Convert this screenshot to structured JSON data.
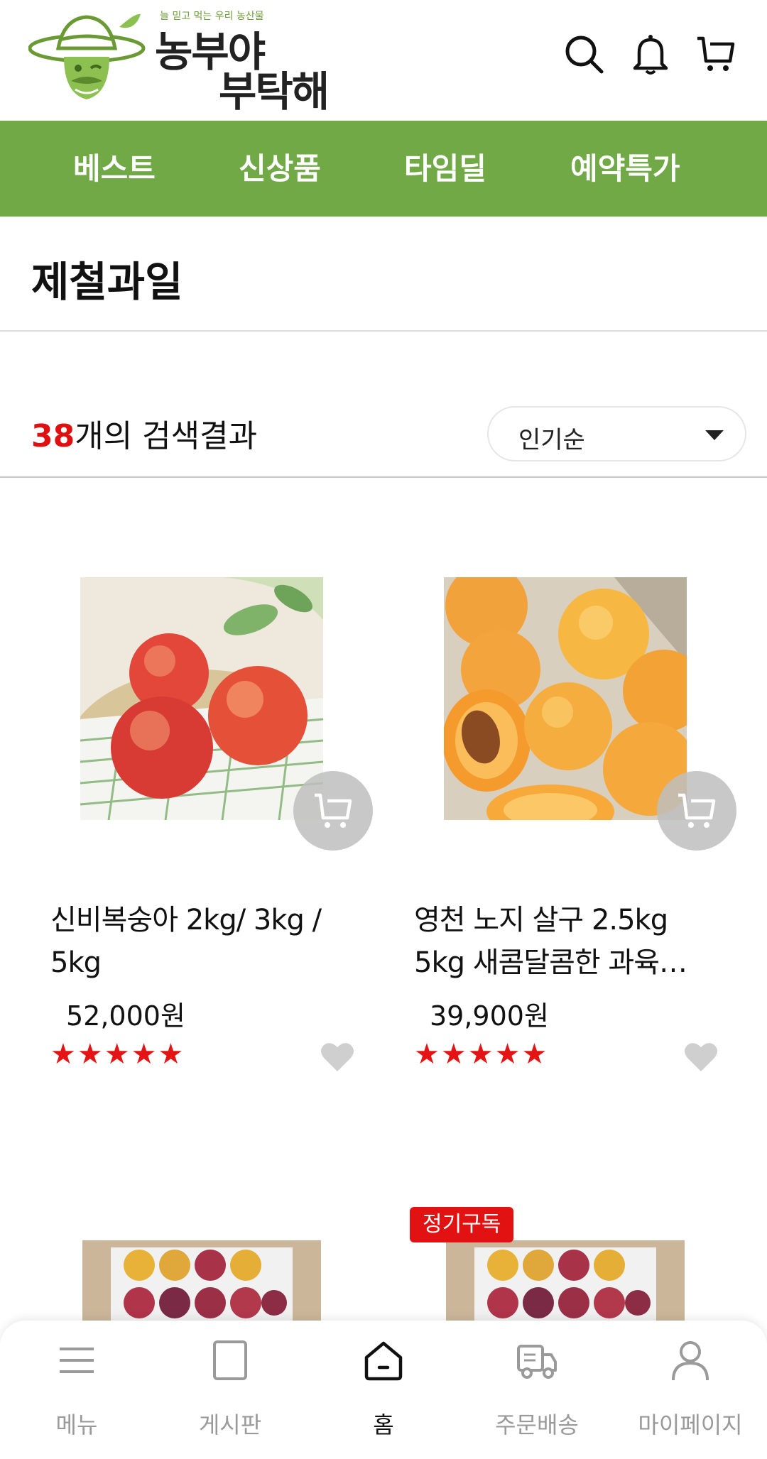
{
  "header": {
    "logo": {
      "tagline": "늘 믿고 먹는 우리 농산물",
      "line1": "농부야",
      "line2": "부탁해"
    },
    "icons": [
      "search-icon",
      "bell-icon",
      "cart-icon"
    ]
  },
  "nav": {
    "items": [
      "베스트",
      "신상품",
      "타임딜",
      "예약특가"
    ]
  },
  "page": {
    "title": "제철과일"
  },
  "results": {
    "count": "38",
    "suffix": "개의 검색결과"
  },
  "sort": {
    "selected": "인기순"
  },
  "products": [
    {
      "name": "신비복숭아 2kg/ 3kg / 5kg",
      "price": "52,000원",
      "rating": 5
    },
    {
      "name": "영천 노지 살구 2.5kg 5kg 새콤달콤한 과육…",
      "price": "39,900원",
      "rating": 5
    },
    {
      "name": "",
      "price": "",
      "rating": null
    },
    {
      "name": "",
      "price": "",
      "rating": null,
      "badge": "정기구독"
    }
  ],
  "colors": {
    "nav_green": "#71a947",
    "accent_red": "#e01010",
    "star_red": "#e41414"
  },
  "tabbar": {
    "tabs": [
      {
        "label": "메뉴",
        "icon": "menu-icon"
      },
      {
        "label": "게시판",
        "icon": "board-icon"
      },
      {
        "label": "홈",
        "icon": "home-icon",
        "active": true
      },
      {
        "label": "주문배송",
        "icon": "truck-icon"
      },
      {
        "label": "마이페이지",
        "icon": "user-icon"
      }
    ]
  }
}
